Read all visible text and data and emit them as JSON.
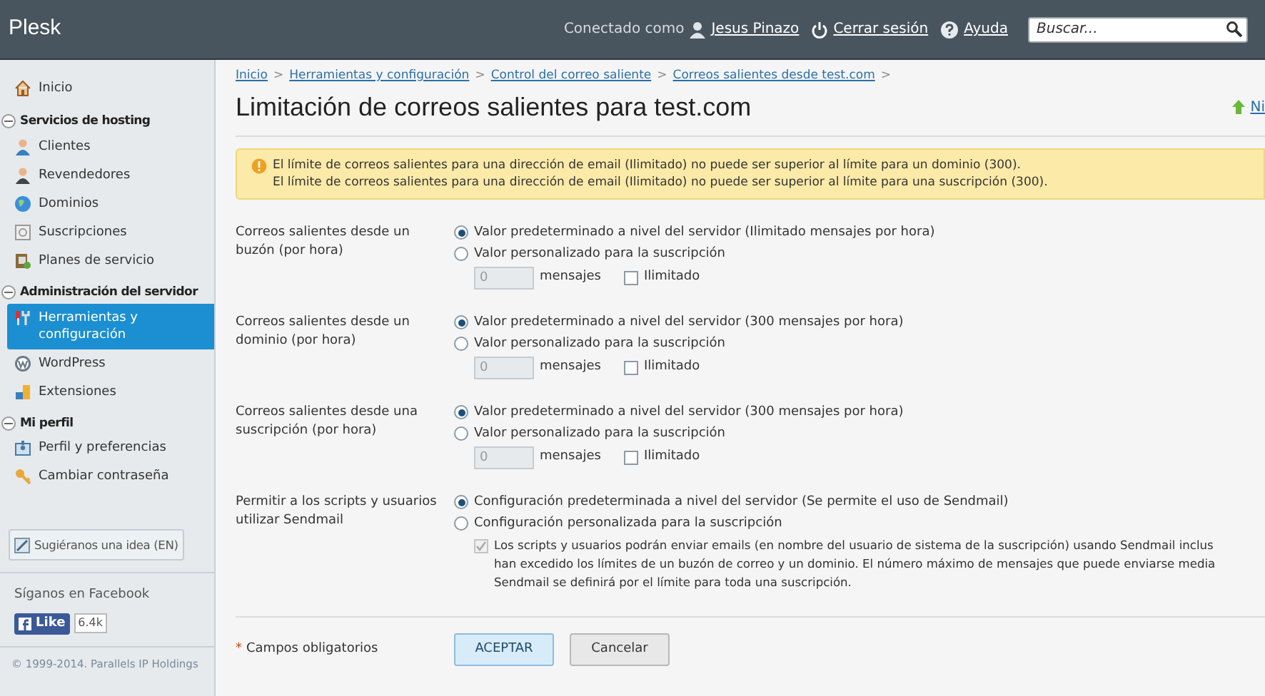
{
  "header": {
    "logo": "Plesk",
    "connected_label": "Conectado como",
    "user": "Jesus Pinazo",
    "logout": "Cerrar sesión",
    "help": "Ayuda",
    "search": {
      "placeholder": "Buscar..."
    }
  },
  "sidebar": {
    "home": {
      "label": "Inicio",
      "selected": false
    },
    "sections": [
      {
        "title": "Servicios de hosting",
        "expanded": true,
        "items": [
          {
            "label": "Clientes",
            "selected": false
          },
          {
            "label": "Revendedores",
            "selected": false
          },
          {
            "label": "Dominios",
            "selected": false
          },
          {
            "label": "Suscripciones",
            "selected": false
          },
          {
            "label": "Planes de servicio",
            "selected": false
          }
        ]
      },
      {
        "title": "Administración del servidor",
        "expanded": true,
        "items": [
          {
            "label": "Herramientas y configuración",
            "selected": true
          },
          {
            "label": "WordPress",
            "selected": false
          },
          {
            "label": "Extensiones",
            "selected": false
          }
        ]
      },
      {
        "title": "Mi perfil",
        "expanded": true,
        "items": [
          {
            "label": "Perfil y preferencias",
            "selected": false
          },
          {
            "label": "Cambiar contraseña",
            "selected": false
          }
        ]
      }
    ],
    "suggest_button": "Sugiéranos una idea (EN)",
    "facebook_title": "Síganos en Facebook",
    "like_button": "Like",
    "like_count": "6.4k",
    "copyright": "© 1999-2014. Parallels IP Holdings"
  },
  "breadcrumbs": [
    {
      "label": "Inicio",
      "separator": ">"
    },
    {
      "label": "Herramientas y configuración",
      "separator": ">"
    },
    {
      "label": "Control del correo saliente",
      "separator": ">"
    },
    {
      "label": "Correos salientes desde test.com",
      "separator": ">"
    }
  ],
  "page_title": "Limitación de correos salientes para test.com",
  "top_right_link": "Ni",
  "warning": [
    "El límite de correos salientes para una dirección de email (Ilimitado) no puede ser superior al límite para un dominio (300).",
    "El límite de correos salientes para una dirección de email (Ilimitado) no puede ser superior al límite para una suscripción (300)."
  ],
  "fields": [
    {
      "kind": "limit",
      "label": "Correos salientes desde un buzón (por hora)",
      "options": [
        {
          "label": "Valor predeterminado a nivel del servidor (Ilimitado mensajes por hora)",
          "selected": true
        },
        {
          "label": "Valor personalizado para la suscripción",
          "selected": false
        }
      ],
      "value": "0",
      "unit": "mensajes",
      "unlimited": {
        "label": "Ilimitado",
        "checked": false
      }
    },
    {
      "kind": "limit",
      "label": "Correos salientes desde un dominio (por hora)",
      "options": [
        {
          "label": "Valor predeterminado a nivel del servidor (300 mensajes por hora)",
          "selected": true
        },
        {
          "label": "Valor personalizado para la suscripción",
          "selected": false
        }
      ],
      "value": "0",
      "unit": "mensajes",
      "unlimited": {
        "label": "Ilimitado",
        "checked": false
      }
    },
    {
      "kind": "limit",
      "label": "Correos salientes desde una suscripción (por hora)",
      "options": [
        {
          "label": "Valor predeterminado a nivel del servidor (300 mensajes por hora)",
          "selected": true
        },
        {
          "label": "Valor personalizado para la suscripción",
          "selected": false
        }
      ],
      "value": "0",
      "unit": "mensajes",
      "unlimited": {
        "label": "Ilimitado",
        "checked": false
      }
    },
    {
      "kind": "sendmail",
      "label": "Permitir a los scripts y usuarios utilizar Sendmail",
      "options": [
        {
          "label": "Configuración predeterminada a nivel del servidor (Se permite el uso de Sendmail)",
          "selected": true
        },
        {
          "label": "Configuración personalizada para la suscripción",
          "selected": false
        }
      ],
      "allow": {
        "checked": true,
        "disabled": true,
        "lines": [
          "Los scripts y usuarios podrán enviar emails (en nombre del usuario de sistema de la suscripción) usando Sendmail inclus",
          "han excedido los límites de un buzón de correo y un dominio. El número máximo de mensajes que puede enviarse media",
          "Sendmail se definirá por el límite para toda una suscripción."
        ]
      }
    }
  ],
  "required_note": {
    "mark": "*",
    "label": "Campos obligatorios"
  },
  "buttons": [
    {
      "label": "ACEPTAR",
      "kind": "primary"
    },
    {
      "label": "Cancelar",
      "kind": "secondary"
    }
  ]
}
